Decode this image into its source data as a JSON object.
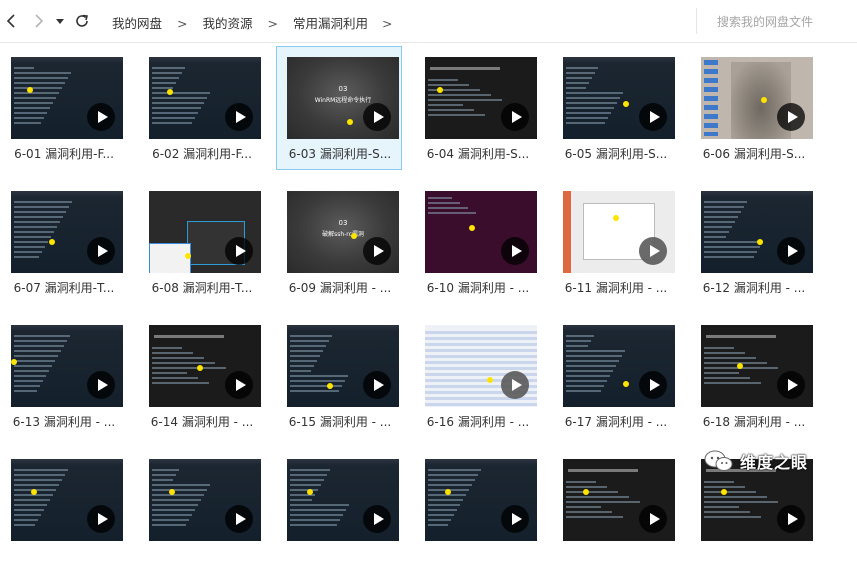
{
  "breadcrumbs": [
    "我的网盘",
    "我的资源",
    "常用漏洞利用"
  ],
  "search": {
    "placeholder": "搜索我的网盘文件"
  },
  "files": [
    {
      "label": "6-01 漏洞利用-F...",
      "style": "term"
    },
    {
      "label": "6-02 漏洞利用-F...",
      "style": "term"
    },
    {
      "label": "6-03 漏洞利用-S...",
      "style": "grey",
      "selected": true
    },
    {
      "label": "6-04 漏洞利用-S...",
      "style": "dark"
    },
    {
      "label": "6-05 漏洞利用-S...",
      "style": "term"
    },
    {
      "label": "6-06 漏洞利用-S...",
      "style": "desk"
    },
    {
      "label": "6-07 漏洞利用-T...",
      "style": "term"
    },
    {
      "label": "6-08 漏洞利用-T...",
      "style": "dlg"
    },
    {
      "label": "6-09 漏洞利用 - ...",
      "style": "grey"
    },
    {
      "label": "6-10 漏洞利用 - ...",
      "style": "purple"
    },
    {
      "label": "6-11 漏洞利用 - ...",
      "style": "white"
    },
    {
      "label": "6-12 漏洞利用 - ...",
      "style": "term"
    },
    {
      "label": "6-13 漏洞利用 - ...",
      "style": "term"
    },
    {
      "label": "6-14 漏洞利用 - ...",
      "style": "dark"
    },
    {
      "label": "6-15 漏洞利用 - ...",
      "style": "term"
    },
    {
      "label": "6-16 漏洞利用 - ...",
      "style": "ws"
    },
    {
      "label": "6-17 漏洞利用 - ...",
      "style": "term"
    },
    {
      "label": "6-18 漏洞利用 - ...",
      "style": "dark"
    },
    {
      "label": "",
      "style": "term"
    },
    {
      "label": "",
      "style": "term"
    },
    {
      "label": "",
      "style": "term"
    },
    {
      "label": "",
      "style": "term"
    },
    {
      "label": "",
      "style": "dark"
    },
    {
      "label": "",
      "style": "dark"
    }
  ],
  "grey_titles": {
    "6-03": [
      "03",
      "WinRM远程命令执行"
    ],
    "6-09": [
      "03",
      "破解ssh-rc漏洞"
    ]
  },
  "watermark": "维度之眼",
  "colors": {
    "selected_bg": "#e6f4fc",
    "selected_border": "#8cc9ef",
    "marker": "#ffe400"
  },
  "icons": [
    "back-arrow-icon",
    "forward-arrow-icon",
    "history-dropdown-icon",
    "refresh-icon",
    "play-icon",
    "wechat-icon"
  ]
}
